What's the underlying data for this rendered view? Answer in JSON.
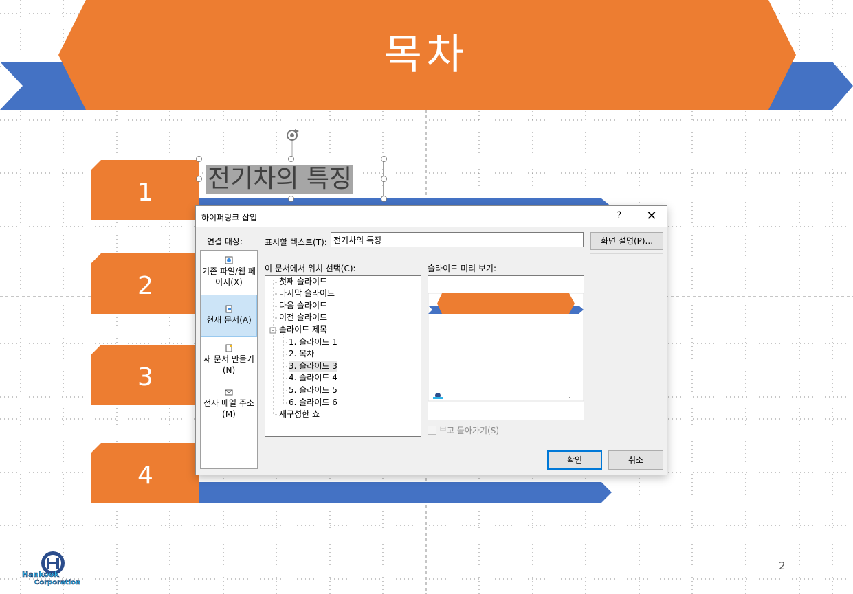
{
  "slide": {
    "title": "목차",
    "items": [
      {
        "number": "1",
        "text": "전기차의 특징"
      },
      {
        "number": "2"
      },
      {
        "number": "3"
      },
      {
        "number": "4"
      }
    ],
    "page_number": "2",
    "logo_text": "Hankook Corporation",
    "colors": {
      "orange": "#ed7d31",
      "blue": "#4472c4"
    }
  },
  "dialog": {
    "title": "하이퍼링크 삽입",
    "help": "?",
    "close": "✕",
    "link_to_label": "연결 대상:",
    "link_to_items": [
      {
        "label": "기존 파일/웹 페이지(X)",
        "icon": "web-page-icon",
        "selected": false
      },
      {
        "label": "현재 문서(A)",
        "icon": "document-icon",
        "selected": true
      },
      {
        "label": "새 문서 만들기(N)",
        "icon": "new-document-icon",
        "selected": false
      },
      {
        "label": "전자 메일 주소(M)",
        "icon": "email-icon",
        "selected": false
      }
    ],
    "text_to_display_label": "표시할 텍스트(T):",
    "text_to_display_value": "전기차의 특징",
    "screentip_button": "화면 설명(P)...",
    "place_label": "이 문서에서 위치 선택(C):",
    "tree": [
      {
        "label": "첫째 슬라이드"
      },
      {
        "label": "마지막 슬라이드"
      },
      {
        "label": "다음 슬라이드"
      },
      {
        "label": "이전 슬라이드"
      },
      {
        "label": "슬라이드 제목"
      },
      {
        "label": "1. 슬라이드 1"
      },
      {
        "label": "2. 목차"
      },
      {
        "label": "3. 슬라이드 3"
      },
      {
        "label": "4. 슬라이드 4"
      },
      {
        "label": "5. 슬라이드 5"
      },
      {
        "label": "6. 슬라이드 6"
      },
      {
        "label": "재구성한 쇼"
      }
    ],
    "selected_tree_item": "3. 슬라이드 3",
    "preview_label": "슬라이드 미리 보기:",
    "show_and_return_label": "보고 돌아가기(S)",
    "ok_button": "확인",
    "cancel_button": "취소"
  }
}
